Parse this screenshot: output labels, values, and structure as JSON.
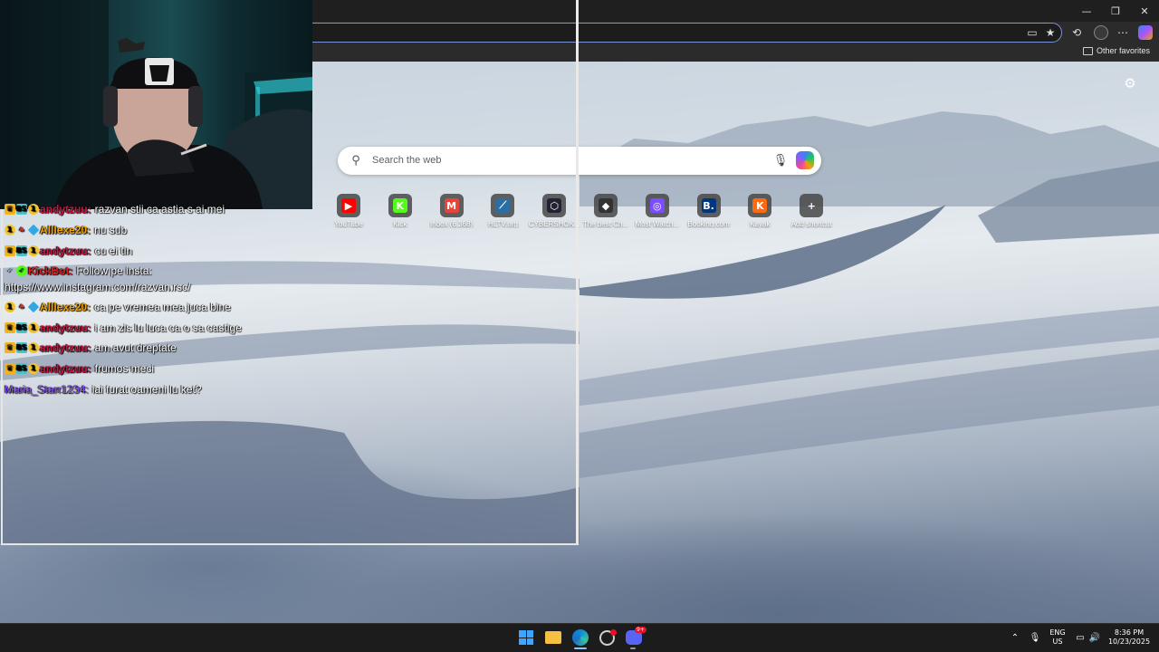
{
  "browser": {
    "window_controls": {
      "minimize": "—",
      "restore": "❐",
      "close": "✕"
    },
    "other_favorites": "Other favorites",
    "search_placeholder": "Search the web",
    "shortcuts": [
      {
        "label": "YouTube",
        "glyph": "▶",
        "color": "#ff0000",
        "icon": "youtube-icon"
      },
      {
        "label": "Kick",
        "glyph": "K",
        "color": "#53fc18",
        "icon": "kick-icon"
      },
      {
        "label": "Inbox (6,368)",
        "glyph": "M",
        "color": "#ea4335",
        "icon": "gmail-icon"
      },
      {
        "label": "HLTV.org",
        "glyph": "⟋",
        "color": "#2b6ea6",
        "icon": "hltv-icon"
      },
      {
        "label": "CYBERSHOK...",
        "glyph": "⬡",
        "color": "#222233",
        "icon": "cybershoke-icon"
      },
      {
        "label": "The best Ch...",
        "glyph": "◆",
        "color": "#333333",
        "icon": "chess-icon"
      },
      {
        "label": "Most Watch...",
        "glyph": "◎",
        "color": "#7c4dff",
        "icon": "most-watched-icon"
      },
      {
        "label": "Booking.com",
        "glyph": "B.",
        "color": "#003580",
        "icon": "booking-icon"
      },
      {
        "label": "Kayak",
        "glyph": "K",
        "color": "#ff690f",
        "icon": "kayak-icon"
      },
      {
        "label": "Add shortcut",
        "glyph": "+",
        "color": "transparent",
        "icon": "add-icon"
      }
    ]
  },
  "chat": {
    "messages": [
      {
        "user": "andytzuu",
        "role": "andy",
        "text": "razvan stii ca astia s ai mei"
      },
      {
        "user": "Alllexe20",
        "role": "allexe",
        "text": "nu sub"
      },
      {
        "user": "andytzuu",
        "role": "andy",
        "text": "cu ei tin"
      },
      {
        "user": "KickBot",
        "role": "kickbot",
        "text": "Follow pe insta:"
      },
      {
        "user": "",
        "role": "cont",
        "text": "https://www.instagram.com/razvan.rsc/"
      },
      {
        "user": "Alllexe20",
        "role": "allexe",
        "text": "ca pe vremea mea juca bine"
      },
      {
        "user": "andytzuu",
        "role": "andy",
        "text": "i am zis lu luca ca o sa castige"
      },
      {
        "user": "andytzuu",
        "role": "andy",
        "text": "am avut dreptate"
      },
      {
        "user": "andytzuu",
        "role": "andy",
        "text": "frumos meci"
      },
      {
        "user": "Maria_Starr1234",
        "role": "maria",
        "text": "iai furat oameni lu ket?"
      }
    ]
  },
  "taskbar": {
    "lang_top": "ENG",
    "lang_bottom": "US",
    "time": "8:36 PM",
    "date": "10/23/2025",
    "discord_badge": "9+"
  }
}
